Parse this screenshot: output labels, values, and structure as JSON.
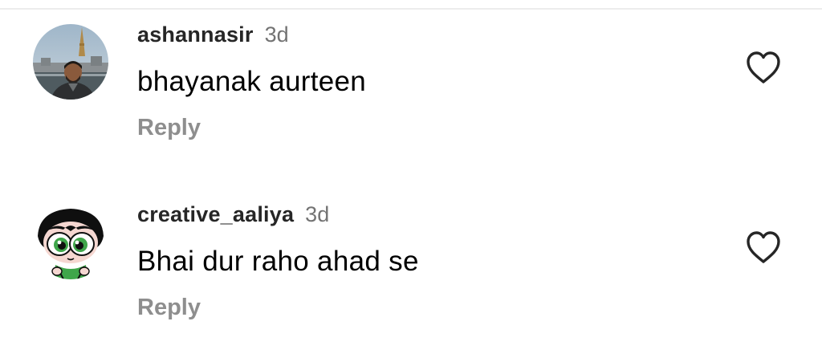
{
  "comments": [
    {
      "username": "ashannasir",
      "time": "3d",
      "text": "bhayanak aurteen",
      "reply_label": "Reply",
      "like_icon": "heart-outline-icon",
      "avatar": "profile-photo-man-outdoors"
    },
    {
      "username": "creative_aaliya",
      "time": "3d",
      "text": "Bhai dur raho ahad se",
      "reply_label": "Reply",
      "like_icon": "heart-outline-icon",
      "avatar": "cartoon-character-avatar"
    }
  ],
  "colors": {
    "username": "#262626",
    "time": "#737373",
    "reply": "#8e8e8e",
    "icon": "#262626",
    "divider": "#ececec"
  }
}
